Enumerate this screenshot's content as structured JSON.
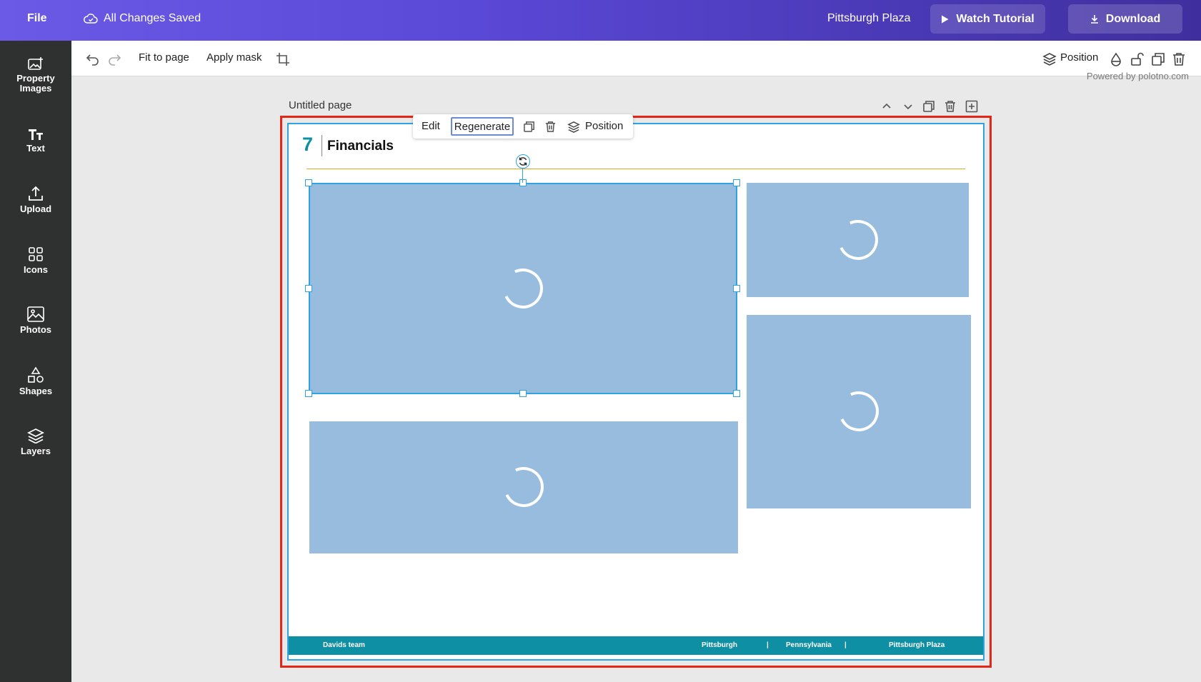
{
  "topbar": {
    "file_label": "File",
    "save_status": "All Changes Saved",
    "project_name": "Pittsburgh Plaza",
    "tutorial_label": "Watch Tutorial",
    "download_label": "Download"
  },
  "sidebar": {
    "items": [
      {
        "label": "Property Images",
        "icon": "property-images-icon"
      },
      {
        "label": "Text",
        "icon": "text-icon"
      },
      {
        "label": "Upload",
        "icon": "upload-icon"
      },
      {
        "label": "Icons",
        "icon": "grid-icon"
      },
      {
        "label": "Photos",
        "icon": "photo-icon"
      },
      {
        "label": "Shapes",
        "icon": "shapes-icon"
      },
      {
        "label": "Layers",
        "icon": "layers-icon"
      }
    ]
  },
  "toolbar": {
    "fit_label": "Fit to page",
    "mask_label": "Apply mask",
    "position_label": "Position"
  },
  "powered_by": "Powered by polotno.com",
  "page": {
    "title": "Untitled page",
    "section_number": "7",
    "section_title": "Financials"
  },
  "context_menu": {
    "edit_label": "Edit",
    "regenerate_label": "Regenerate",
    "position_label": "Position"
  },
  "footer": {
    "team": "Davids team",
    "city": "Pittsburgh",
    "sep1": "|",
    "state": "Pennsylvania",
    "sep2": "|",
    "property": "Pittsburgh Plaza"
  },
  "colors": {
    "accent": "#0f8fa3",
    "selection": "#2ea3e0",
    "placeholder": "#97bcde",
    "canvas_highlight": "#e52515"
  }
}
